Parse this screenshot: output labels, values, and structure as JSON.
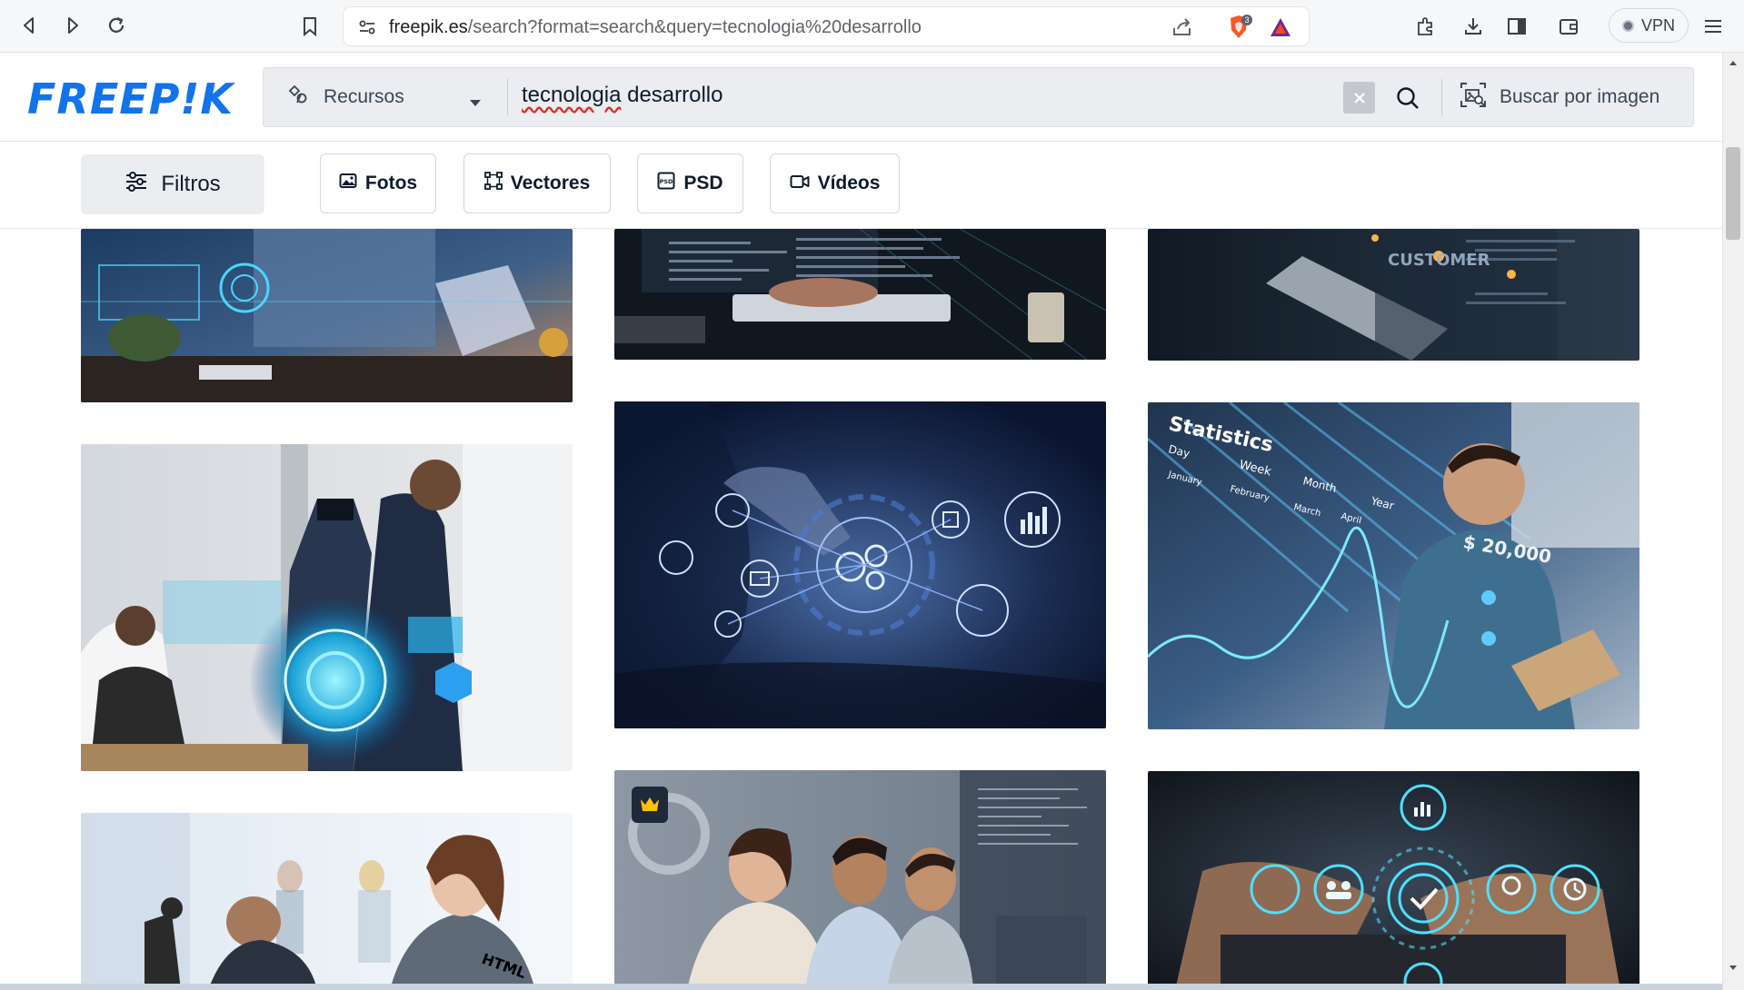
{
  "browser": {
    "url_host": "freepik.es",
    "url_path": "/search?format=search&query=tecnologia%20desarrollo",
    "shield_badge": "3",
    "vpn_label": "VPN"
  },
  "header": {
    "logo": "FREEP!K",
    "search": {
      "resource_label": "Recursos",
      "query_misspelled": "tecnologia",
      "query_rest": " desarrollo",
      "image_search_label": "Buscar por imagen"
    }
  },
  "filters": {
    "filters_label": "Filtros",
    "chips": [
      {
        "label": "Fotos",
        "icon": "photo-icon"
      },
      {
        "label": "Vectores",
        "icon": "vector-icon"
      },
      {
        "label": "PSD",
        "icon": "psd-icon"
      },
      {
        "label": "Vídeos",
        "icon": "video-icon"
      }
    ]
  },
  "gallery": {
    "tiles": [
      {
        "id": "tile-1",
        "subject": "person-laptop-hologram",
        "premium": false
      },
      {
        "id": "tile-2",
        "subject": "code-screen-keyboard",
        "premium": false
      },
      {
        "id": "tile-3",
        "subject": "businessman-laptop-customer",
        "premium": false,
        "overlay_text": "CUSTOMER"
      },
      {
        "id": "tile-4",
        "subject": "team-vr-hologram",
        "premium": false
      },
      {
        "id": "tile-5",
        "subject": "gears-network-touch",
        "premium": false
      },
      {
        "id": "tile-6",
        "subject": "man-tablet-statistics",
        "premium": false,
        "overlay_text": "Statistics",
        "overlay_sub": [
          "Day",
          "Week",
          "Month",
          "Year",
          "January",
          "February",
          "March",
          "April"
        ],
        "overlay_value": "$ 20,000"
      },
      {
        "id": "tile-7",
        "subject": "woman-html-office",
        "premium": false,
        "overlay_text": "HTML"
      },
      {
        "id": "tile-8",
        "subject": "team-looking-screen",
        "premium": true
      },
      {
        "id": "tile-9",
        "subject": "keyboard-icons-check",
        "premium": false
      }
    ]
  },
  "colors": {
    "brand": "#1273eb",
    "text": "#0e1b2c",
    "search_bg": "#ebedf0"
  }
}
